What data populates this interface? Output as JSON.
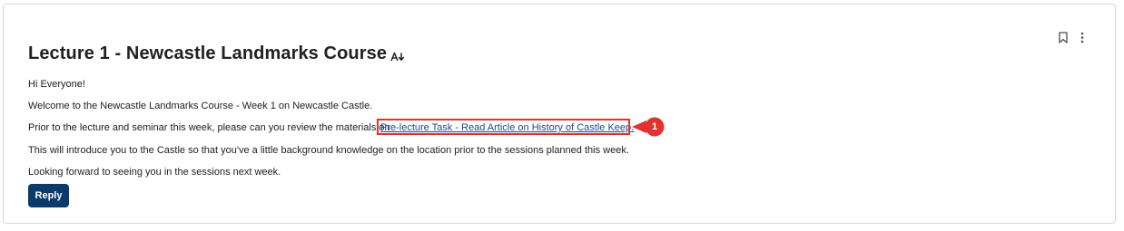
{
  "post": {
    "title": "Lecture 1 - Newcastle Landmarks Course",
    "greeting": "Hi Everyone!",
    "welcome": "Welcome to the Newcastle Landmarks Course - Week 1 on Newcastle Castle.",
    "prior_text": "Prior to the lecture and seminar this week, please can you review the materials on",
    "task_link": "Pre-lecture Task - Read Article on History of Castle Keep.",
    "intro": "This will introduce you to the Castle so that you've a little background knowledge on the location prior to the sessions planned this week.",
    "closing": "Looking forward to seeing you in the sessions next week.",
    "reply_label": "Reply"
  },
  "annotation": {
    "number": "1",
    "color": "#e0332f"
  },
  "icons": {
    "bookmark": "bookmark-icon",
    "more": "more-options-icon",
    "translate": "translate-icon"
  },
  "colors": {
    "reply_button": "#0c3a6b",
    "link": "#1a4a8c",
    "border": "#d3d9e3"
  }
}
